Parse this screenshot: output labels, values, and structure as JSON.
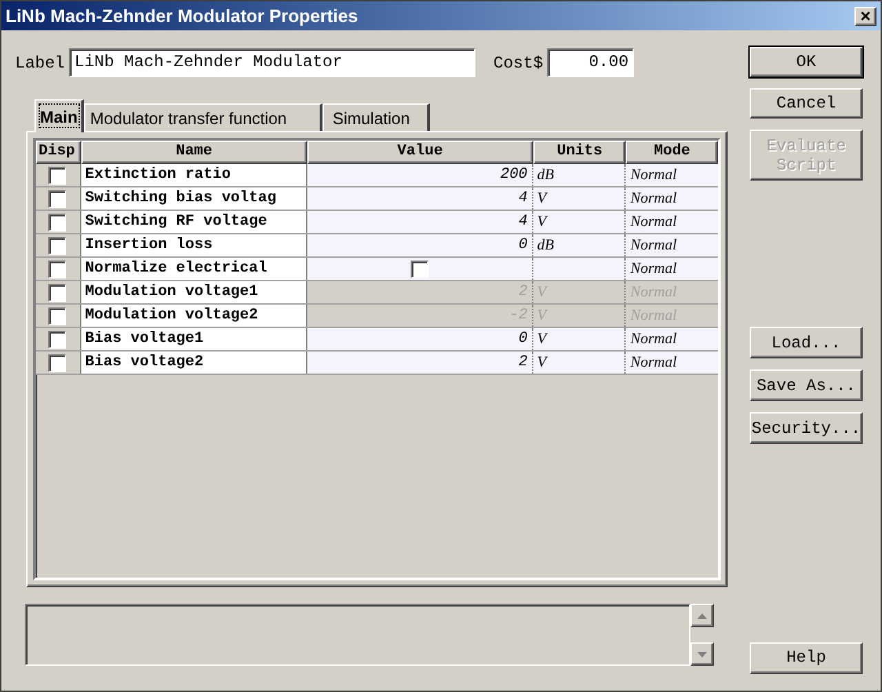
{
  "window": {
    "title": "LiNb Mach-Zehnder Modulator Properties",
    "close": "×"
  },
  "label_field": {
    "label": "Label",
    "value": "LiNb Mach-Zehnder Modulator"
  },
  "cost_field": {
    "label": "Cost$",
    "value": "0.00"
  },
  "tabs": [
    {
      "label": "Main",
      "selected": true
    },
    {
      "label": "Modulator transfer function",
      "selected": false
    },
    {
      "label": "Simulation",
      "selected": false
    }
  ],
  "table": {
    "columns": [
      "Disp",
      "Name",
      "Value",
      "Units",
      "Mode"
    ],
    "rows": [
      {
        "disp": false,
        "name": "Extinction ratio",
        "kind": "number",
        "value": "200",
        "units": "dB",
        "mode": "Normal",
        "disabled": false
      },
      {
        "disp": false,
        "name": "Switching bias voltag",
        "kind": "number",
        "value": "4",
        "units": "V",
        "mode": "Normal",
        "disabled": false
      },
      {
        "disp": false,
        "name": "Switching RF voltage",
        "kind": "number",
        "value": "4",
        "units": "V",
        "mode": "Normal",
        "disabled": false
      },
      {
        "disp": false,
        "name": "Insertion loss",
        "kind": "number",
        "value": "0",
        "units": "dB",
        "mode": "Normal",
        "disabled": false
      },
      {
        "disp": false,
        "name": "Normalize electrical",
        "kind": "checkbox",
        "checked": false,
        "mode": "Normal",
        "disabled": false
      },
      {
        "disp": false,
        "name": "Modulation voltage1",
        "kind": "number",
        "value": "2",
        "units": "V",
        "mode": "Normal",
        "disabled": true
      },
      {
        "disp": false,
        "name": "Modulation voltage2",
        "kind": "number",
        "value": "-2",
        "units": "V",
        "mode": "Normal",
        "disabled": true
      },
      {
        "disp": false,
        "name": "Bias voltage1",
        "kind": "number",
        "value": "0",
        "units": "V",
        "mode": "Normal",
        "disabled": false
      },
      {
        "disp": false,
        "name": "Bias voltage2",
        "kind": "number",
        "value": "2",
        "units": "V",
        "mode": "Normal",
        "disabled": false
      }
    ]
  },
  "buttons_top": [
    {
      "label": "OK",
      "disabled": false,
      "default": true
    },
    {
      "label": "Cancel",
      "disabled": false,
      "default": false
    },
    {
      "label": "Evaluate Script",
      "disabled": true,
      "default": false
    }
  ],
  "buttons_middle": [
    {
      "label": "Load...",
      "disabled": false
    },
    {
      "label": "Save As...",
      "disabled": false
    },
    {
      "label": "Security...",
      "disabled": false
    }
  ],
  "help_button": {
    "label": "Help"
  }
}
